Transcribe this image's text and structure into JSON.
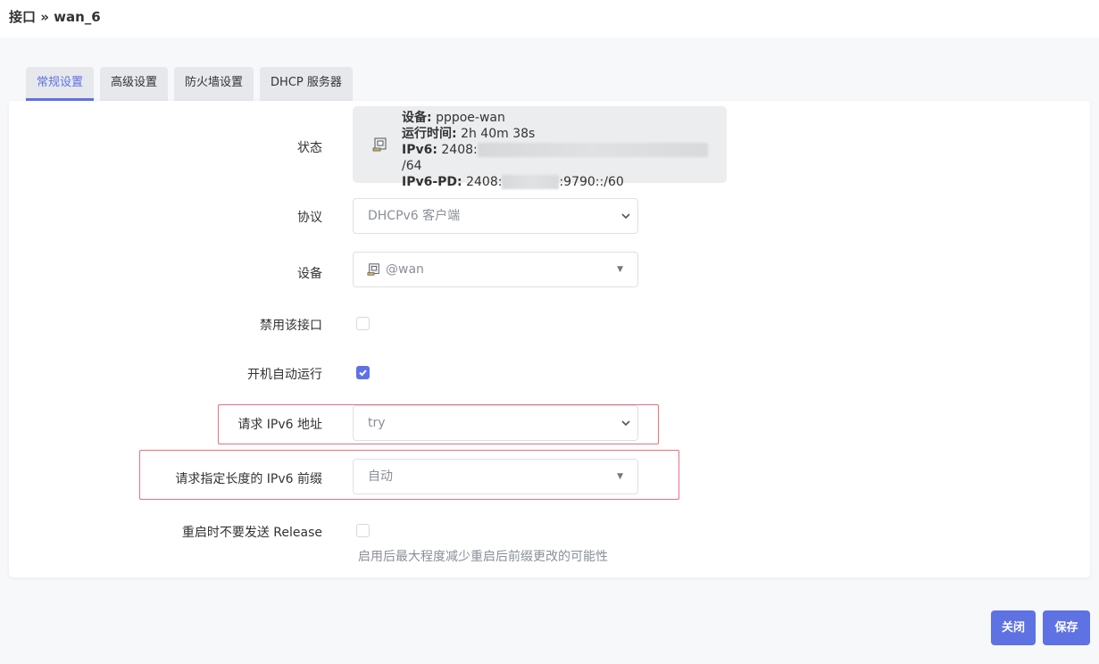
{
  "breadcrumb": "接口 » wan_6",
  "tabs": [
    {
      "label": "常规设置",
      "active": true
    },
    {
      "label": "高级设置",
      "active": false
    },
    {
      "label": "防火墙设置",
      "active": false
    },
    {
      "label": "DHCP 服务器",
      "active": false
    }
  ],
  "fields": {
    "status_label": "状态",
    "protocol_label": "协议",
    "device_label": "设备",
    "disable_label": "禁用该接口",
    "autostart_label": "开机自动运行",
    "reqaddress_label": "请求 IPv6 地址",
    "reqprefix_label": "请求指定长度的 IPv6 前缀",
    "norelease_label": "重启时不要发送 Release"
  },
  "status": {
    "device_key": "设备:",
    "device_val": "pppoe-wan",
    "uptime_key": "运行时间:",
    "uptime_val": "2h 40m 38s",
    "ipv6_key": "IPv6:",
    "ipv6_prefix": "2408:",
    "ipv6_suffix": "/64",
    "pd_key": "IPv6-PD:",
    "pd_prefix": "2408:",
    "pd_suffix": ":9790::/60"
  },
  "protocol_value": "DHCPv6 客户端",
  "device_value": "@wan",
  "disable_checked": false,
  "autostart_checked": true,
  "reqaddress_value": "try",
  "reqprefix_value": "自动",
  "norelease_checked": false,
  "norelease_help": "启用后最大程度减少重启后前缀更改的可能性",
  "buttons": {
    "close": "关闭",
    "save": "保存"
  },
  "colors": {
    "accent": "#5e72e4",
    "highlight": "#e8707e"
  },
  "icons": [
    "network-port-icon",
    "chevron-down-icon",
    "caret-down-icon",
    "checkmark-icon"
  ]
}
